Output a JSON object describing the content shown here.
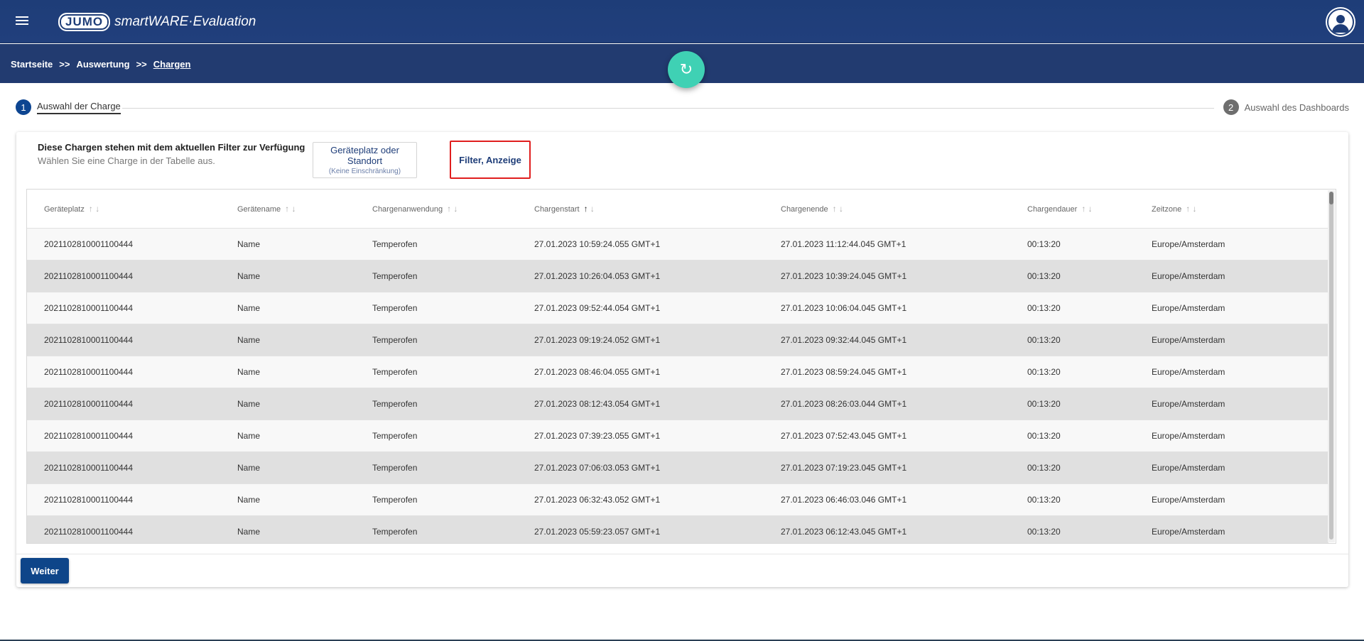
{
  "header": {
    "logo_badge": "JUMO",
    "logo_text": "smartWARE·Evaluation"
  },
  "breadcrumb": {
    "items": [
      "Startseite",
      "Auswertung",
      "Chargen"
    ],
    "separator": ">>"
  },
  "refresh_icon": "↻",
  "stepper": {
    "step1": {
      "number": "1",
      "label": "Auswahl der Charge"
    },
    "step2": {
      "number": "2",
      "label": "Auswahl des Dashboards"
    }
  },
  "card": {
    "title": "Diese Chargen stehen mit dem aktuellen Filter zur Verfügung",
    "subtitle": "Wählen Sie eine Charge in der Tabelle aus.",
    "location_filter": {
      "label": "Geräteplatz oder Standort",
      "sublabel": "(Keine Einschränkung)"
    },
    "display_filter": {
      "label": "Filter, Anzeige"
    },
    "next_label": "Weiter"
  },
  "table": {
    "columns": [
      "Geräteplatz",
      "Gerätename",
      "Chargenanwendung",
      "Chargenstart",
      "Chargenende",
      "Chargendauer",
      "Zeitzone"
    ],
    "rows": [
      [
        "2021102810001100444",
        "Name",
        "Temperofen",
        "27.01.2023 10:59:24.055 GMT+1",
        "27.01.2023 11:12:44.045 GMT+1",
        "00:13:20",
        "Europe/Amsterdam"
      ],
      [
        "2021102810001100444",
        "Name",
        "Temperofen",
        "27.01.2023 10:26:04.053 GMT+1",
        "27.01.2023 10:39:24.045 GMT+1",
        "00:13:20",
        "Europe/Amsterdam"
      ],
      [
        "2021102810001100444",
        "Name",
        "Temperofen",
        "27.01.2023 09:52:44.054 GMT+1",
        "27.01.2023 10:06:04.045 GMT+1",
        "00:13:20",
        "Europe/Amsterdam"
      ],
      [
        "2021102810001100444",
        "Name",
        "Temperofen",
        "27.01.2023 09:19:24.052 GMT+1",
        "27.01.2023 09:32:44.045 GMT+1",
        "00:13:20",
        "Europe/Amsterdam"
      ],
      [
        "2021102810001100444",
        "Name",
        "Temperofen",
        "27.01.2023 08:46:04.055 GMT+1",
        "27.01.2023 08:59:24.045 GMT+1",
        "00:13:20",
        "Europe/Amsterdam"
      ],
      [
        "2021102810001100444",
        "Name",
        "Temperofen",
        "27.01.2023 08:12:43.054 GMT+1",
        "27.01.2023 08:26:03.044 GMT+1",
        "00:13:20",
        "Europe/Amsterdam"
      ],
      [
        "2021102810001100444",
        "Name",
        "Temperofen",
        "27.01.2023 07:39:23.055 GMT+1",
        "27.01.2023 07:52:43.045 GMT+1",
        "00:13:20",
        "Europe/Amsterdam"
      ],
      [
        "2021102810001100444",
        "Name",
        "Temperofen",
        "27.01.2023 07:06:03.053 GMT+1",
        "27.01.2023 07:19:23.045 GMT+1",
        "00:13:20",
        "Europe/Amsterdam"
      ],
      [
        "2021102810001100444",
        "Name",
        "Temperofen",
        "27.01.2023 06:32:43.052 GMT+1",
        "27.01.2023 06:46:03.046 GMT+1",
        "00:13:20",
        "Europe/Amsterdam"
      ],
      [
        "2021102810001100444",
        "Name",
        "Temperofen",
        "27.01.2023 05:59:23.057 GMT+1",
        "27.01.2023 06:12:43.045 GMT+1",
        "00:13:20",
        "Europe/Amsterdam"
      ]
    ],
    "sort_arrows": "↑ ↓"
  }
}
